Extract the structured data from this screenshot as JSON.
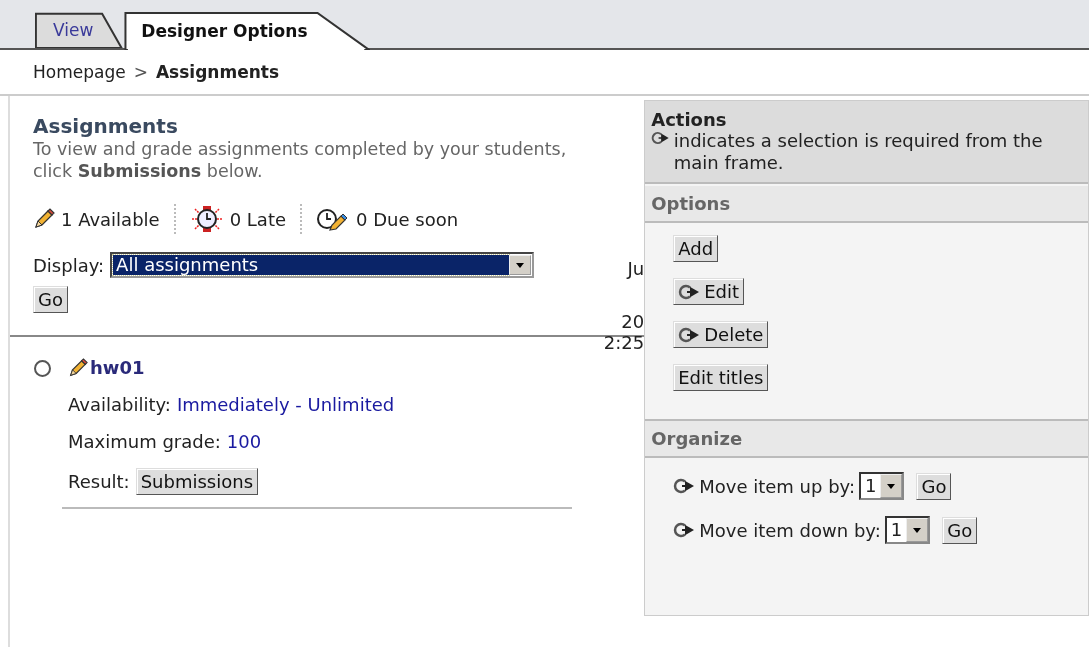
{
  "tabs": [
    {
      "label": "View",
      "selected": false
    },
    {
      "label": "Designer Options",
      "selected": true
    }
  ],
  "breadcrumb": {
    "items": [
      {
        "label": "Homepage",
        "current": false
      },
      {
        "label": "Assignments",
        "current": true
      }
    ],
    "separator": ">"
  },
  "main": {
    "title": "Assignments",
    "description": "To view and grade assignments completed by your students, click **Submissions** below.",
    "stats": [
      {
        "kind": "available",
        "text": "1 Available"
      },
      {
        "kind": "late",
        "text": "0 Late"
      },
      {
        "kind": "due_soon",
        "text": "0 Due soon"
      }
    ],
    "display": {
      "label": "Display:",
      "value": "All assignments"
    },
    "go_button": "Go",
    "clipped_texts": [
      "Ju",
      "20",
      "2:25"
    ],
    "assignments": [
      {
        "title": "hw01",
        "selected": false,
        "availability_label": "Availability:",
        "availability": "Immediately - Unlimited",
        "grade_label": "Maximum grade:",
        "grade": "100",
        "result_label": "Result:",
        "result_button": "Submissions"
      }
    ]
  },
  "actions": {
    "title": "Actions",
    "note": "indicates a selection is required from the main frame."
  },
  "options": {
    "title": "Options",
    "buttons": [
      {
        "label": "Add",
        "requires_selection": false
      },
      {
        "label": "Edit",
        "requires_selection": true
      },
      {
        "label": "Delete",
        "requires_selection": true
      },
      {
        "label": "Edit titles",
        "requires_selection": false
      }
    ]
  },
  "organize": {
    "title": "Organize",
    "rows": [
      {
        "label": "Move item up by:",
        "value": "1",
        "button": "Go"
      },
      {
        "label": "Move item down by:",
        "value": "1",
        "button": "Go"
      }
    ]
  }
}
